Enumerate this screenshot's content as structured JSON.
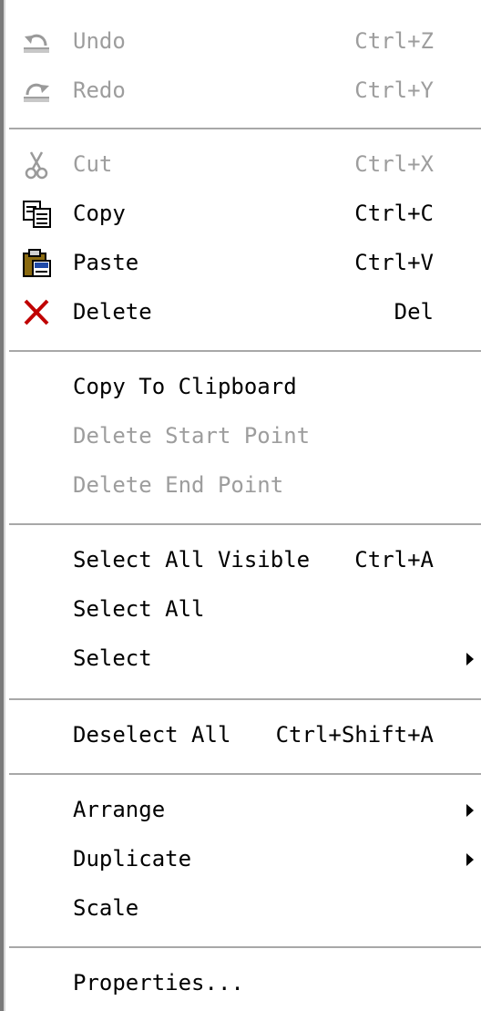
{
  "menu": {
    "items": [
      {
        "label": "Undo",
        "shortcut": "Ctrl+Z",
        "icon": "undo-icon",
        "enabled": false
      },
      {
        "label": "Redo",
        "shortcut": "Ctrl+Y",
        "icon": "redo-icon",
        "enabled": false
      },
      {
        "label": "Cut",
        "shortcut": "Ctrl+X",
        "icon": "scissors-icon",
        "enabled": false
      },
      {
        "label": "Copy",
        "shortcut": "Ctrl+C",
        "icon": "copy-icon",
        "enabled": true
      },
      {
        "label": "Paste",
        "shortcut": "Ctrl+V",
        "icon": "paste-icon",
        "enabled": true
      },
      {
        "label": "Delete",
        "shortcut": "Del",
        "icon": "delete-x-icon",
        "enabled": true
      },
      {
        "label": "Copy To Clipboard",
        "shortcut": "",
        "enabled": true
      },
      {
        "label": "Delete Start Point",
        "shortcut": "",
        "enabled": false
      },
      {
        "label": "Delete End Point",
        "shortcut": "",
        "enabled": false
      },
      {
        "label": "Select All Visible",
        "shortcut": "Ctrl+A",
        "enabled": true
      },
      {
        "label": "Select All",
        "shortcut": "",
        "enabled": true
      },
      {
        "label": "Select",
        "shortcut": "",
        "enabled": true,
        "submenu": true
      },
      {
        "label": "Deselect All",
        "shortcut": "Ctrl+Shift+A",
        "enabled": true
      },
      {
        "label": "Arrange",
        "shortcut": "",
        "enabled": true,
        "submenu": true
      },
      {
        "label": "Duplicate",
        "shortcut": "",
        "enabled": true,
        "submenu": true
      },
      {
        "label": "Scale",
        "shortcut": "",
        "enabled": true
      },
      {
        "label": "Properties...",
        "shortcut": "",
        "enabled": true
      }
    ]
  },
  "colors": {
    "text": "#000000",
    "disabled_text": "#9d9d9d",
    "separator": "#a8a8a8",
    "delete_icon": "#c00000"
  }
}
